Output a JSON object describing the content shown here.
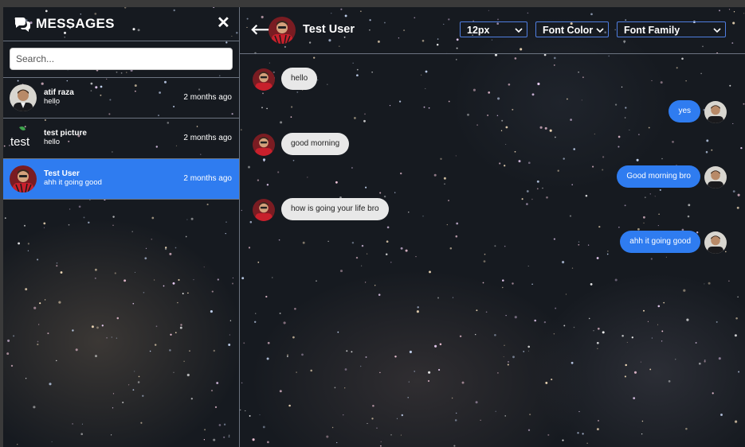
{
  "sidebar": {
    "title": "MESSAGES",
    "search_placeholder": "Search...",
    "conversations": [
      {
        "name": "atif raza",
        "preview": "hello",
        "time": "2 months ago",
        "active": false
      },
      {
        "name": "test picture",
        "preview": "hello",
        "time": "2 months ago",
        "active": false,
        "avatar_text": "test"
      },
      {
        "name": "Test User",
        "preview": "ahh it going good",
        "time": "2 months ago",
        "active": true
      }
    ]
  },
  "chat": {
    "contact_name": "Test User",
    "font_size_select": "12px",
    "font_color_select": "Font Color",
    "font_family_select": "Font Family",
    "messages": [
      {
        "direction": "in",
        "text": "hello"
      },
      {
        "direction": "out",
        "text": "yes"
      },
      {
        "direction": "in",
        "text": "good morning"
      },
      {
        "direction": "out",
        "text": "Good morning bro"
      },
      {
        "direction": "in",
        "text": "how is going your life bro"
      },
      {
        "direction": "out",
        "text": "ahh it going good"
      }
    ]
  },
  "colors": {
    "accent": "#2f7cf0",
    "incoming_bubble": "#e8e8e8",
    "divider": "#6b7380"
  },
  "icons": [
    "comments-icon",
    "close-icon",
    "back-arrow-icon",
    "chevron-down-icon"
  ]
}
